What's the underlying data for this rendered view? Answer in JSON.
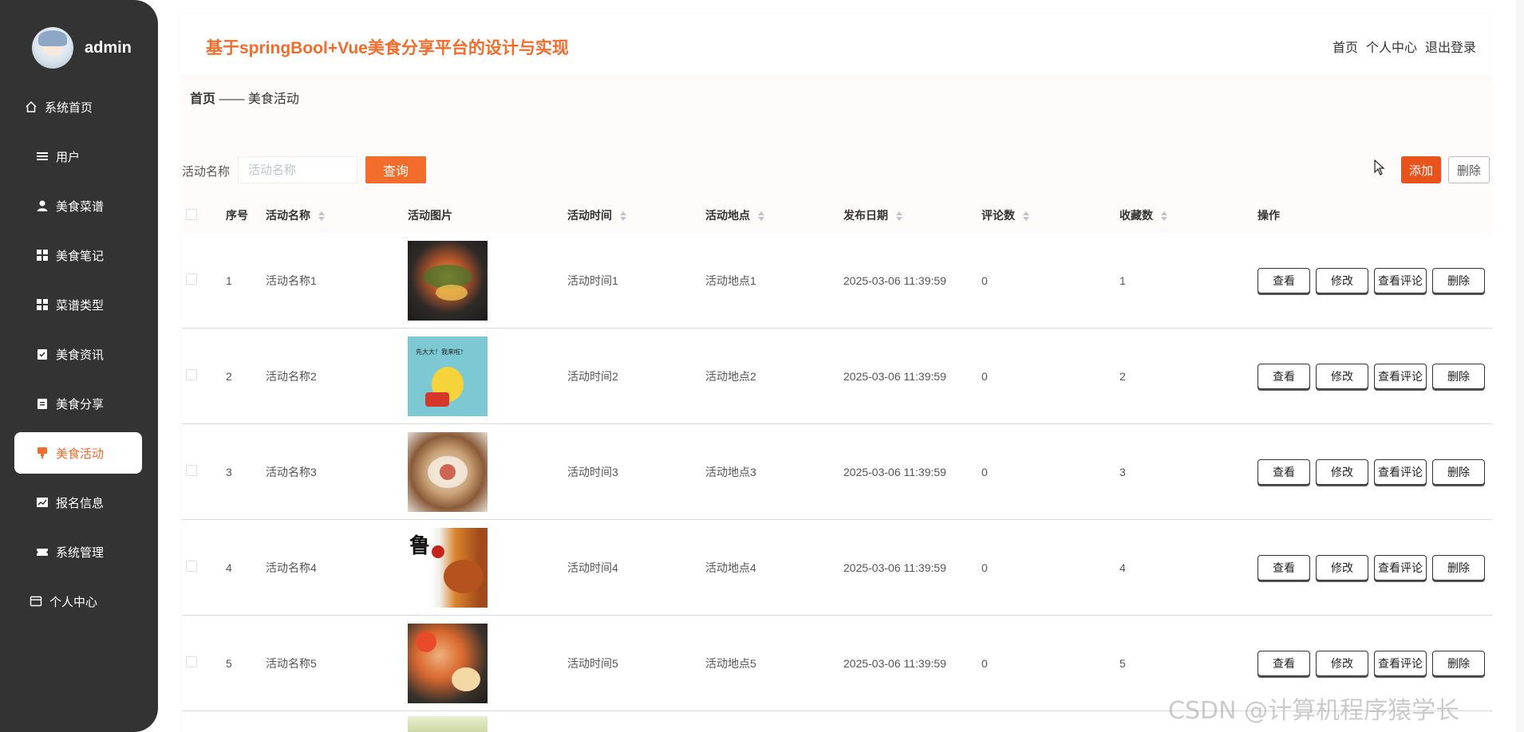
{
  "user": {
    "name": "admin"
  },
  "sidebar": {
    "items": [
      {
        "label": "系统首页",
        "icon": "home-icon",
        "active": false
      },
      {
        "label": "用户",
        "icon": "list-icon",
        "active": false
      },
      {
        "label": "美食菜谱",
        "icon": "user-icon",
        "active": false
      },
      {
        "label": "美食笔记",
        "icon": "grid-icon",
        "active": false
      },
      {
        "label": "菜谱类型",
        "icon": "grid-icon",
        "active": false
      },
      {
        "label": "美食资讯",
        "icon": "clipboard-check-icon",
        "active": false
      },
      {
        "label": "美食分享",
        "icon": "clipboard-icon",
        "active": false
      },
      {
        "label": "美食活动",
        "icon": "flag-icon",
        "active": true
      },
      {
        "label": "报名信息",
        "icon": "chart-icon",
        "active": false
      },
      {
        "label": "系统管理",
        "icon": "ticket-icon",
        "active": false
      },
      {
        "label": "个人中心",
        "icon": "card-icon",
        "active": false
      }
    ]
  },
  "header": {
    "title": "基于springBool+Vue美食分享平台的设计与实现",
    "links": [
      "首页",
      "个人中心",
      "退出登录"
    ]
  },
  "breadcrumb": {
    "home": "首页",
    "separator": "——",
    "current": "美食活动"
  },
  "search": {
    "label": "活动名称",
    "placeholder": "活动名称",
    "value": "",
    "query_label": "查询"
  },
  "toolbar": {
    "add_label": "添加",
    "delete_label": "删除"
  },
  "table": {
    "headers": {
      "no": "序号",
      "name": "活动名称",
      "image": "活动图片",
      "time": "活动时间",
      "place": "活动地点",
      "date": "发布日期",
      "comments": "评论数",
      "favorites": "收藏数",
      "ops": "操作"
    },
    "rows": [
      {
        "no": "1",
        "name": "活动名称1",
        "time": "活动时间1",
        "place": "活动地点1",
        "date": "2025-03-06 11:39:59",
        "comments": "0",
        "favorites": "1"
      },
      {
        "no": "2",
        "name": "活动名称2",
        "time": "活动时间2",
        "place": "活动地点2",
        "date": "2025-03-06 11:39:59",
        "comments": "0",
        "favorites": "2"
      },
      {
        "no": "3",
        "name": "活动名称3",
        "time": "活动时间3",
        "place": "活动地点3",
        "date": "2025-03-06 11:39:59",
        "comments": "0",
        "favorites": "3"
      },
      {
        "no": "4",
        "name": "活动名称4",
        "time": "活动时间4",
        "place": "活动地点4",
        "date": "2025-03-06 11:39:59",
        "comments": "0",
        "favorites": "4"
      },
      {
        "no": "5",
        "name": "活动名称5",
        "time": "活动时间5",
        "place": "活动地点5",
        "date": "2025-03-06 11:39:59",
        "comments": "0",
        "favorites": "5"
      }
    ],
    "op_labels": {
      "view": "查看",
      "edit": "修改",
      "view_comments": "查看评论",
      "delete": "删除"
    }
  },
  "thumb4_text": "鲁",
  "thumb2_text": "先大大！我来啦！",
  "watermark": "CSDN @计算机程序猿学长",
  "colors": {
    "accent": "#f26c2b",
    "sidebar_bg": "#333333",
    "add_button": "#e8521b"
  }
}
